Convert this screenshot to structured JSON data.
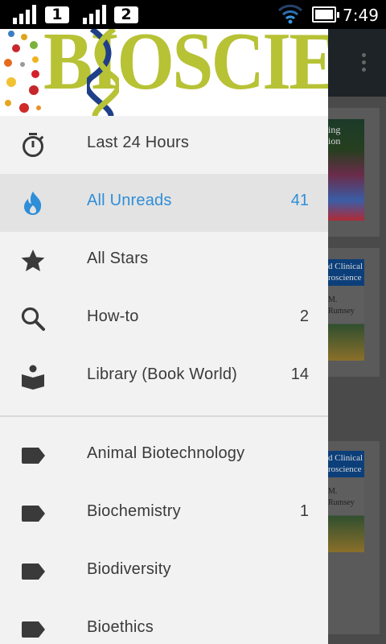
{
  "status_bar": {
    "sim1_label": "1",
    "sim2_label": "2",
    "time": "7:49",
    "icons": [
      "signal-icon",
      "signal-icon",
      "wifi-icon",
      "battery-icon"
    ]
  },
  "banner": {
    "logo_text": "BIOSCIENCE"
  },
  "background_app": {
    "cover1_text": "ing\nion",
    "cover2_text": "d Clinical\nroscience",
    "cover2_author": "M. Rumsey",
    "cover3_text": "d Clinical\nroscience",
    "cover3_author": "M. Rumsey"
  },
  "drawer": {
    "items": [
      {
        "label": "Last 24 Hours",
        "count": "",
        "icon": "timer-icon",
        "selected": false
      },
      {
        "label": "All Unreads",
        "count": "41",
        "icon": "flame-icon",
        "selected": true
      },
      {
        "label": "All Stars",
        "count": "",
        "icon": "star-icon",
        "selected": false
      },
      {
        "label": "How-to",
        "count": "2",
        "icon": "search-icon",
        "selected": false
      },
      {
        "label": "Library (Book World)",
        "count": "14",
        "icon": "book-reader-icon",
        "selected": false
      }
    ],
    "categories": [
      {
        "label": "Animal Biotechnology",
        "count": "",
        "icon": "label-icon"
      },
      {
        "label": "Biochemistry",
        "count": "1",
        "icon": "label-icon"
      },
      {
        "label": "Biodiversity",
        "count": "",
        "icon": "label-icon"
      },
      {
        "label": "Bioethics",
        "count": "",
        "icon": "label-icon"
      }
    ]
  },
  "colors": {
    "accent": "#2f8ed8",
    "drawer_bg": "#f2f2f2",
    "selected_bg": "#e3e3e3",
    "icon": "#3a3a3a"
  }
}
